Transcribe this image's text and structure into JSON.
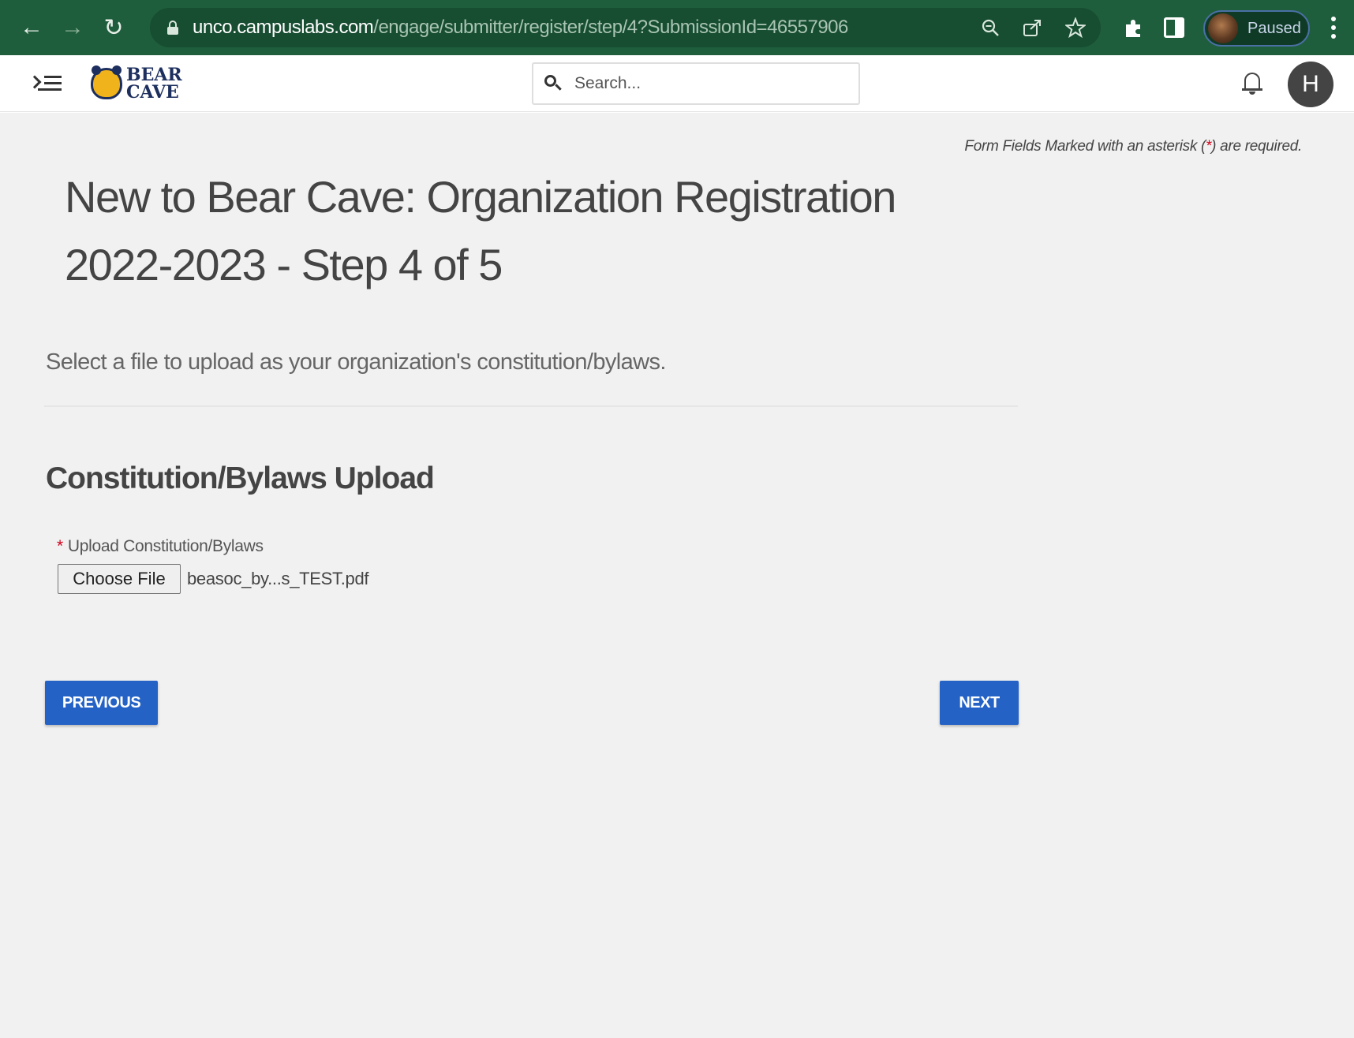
{
  "browser": {
    "url_host": "unco.campuslabs.com",
    "url_path": "/engage/submitter/register/step/4?SubmissionId=46557906",
    "profile_label": "Paused",
    "icons": [
      "back-arrow-icon",
      "forward-arrow-icon",
      "reload-icon",
      "lock-icon",
      "zoom-icon",
      "share-icon",
      "star-icon",
      "puzzle-icon",
      "side-panel-icon",
      "menu-dots-icon"
    ]
  },
  "header": {
    "logo_line1": "BEAR",
    "logo_line2": "CAVE",
    "search_placeholder": "Search...",
    "avatar_initial": "H"
  },
  "form": {
    "required_note_prefix": "Form Fields Marked with an asterisk (",
    "required_note_asterisk": "*",
    "required_note_suffix": ") are required.",
    "title": "New to Bear Cave: Organization Registration 2022-2023 - Step 4 of 5",
    "subtitle": "Select a file to upload as your organization's constitution/bylaws.",
    "section_title": "Constitution/Bylaws Upload",
    "field_required_mark": "*",
    "field_label": "Upload Constitution/Bylaws",
    "choose_file_label": "Choose File",
    "file_name": "beasoc_by...s_TEST.pdf"
  },
  "buttons": {
    "previous": "PREVIOUS",
    "next": "NEXT"
  },
  "colors": {
    "browser_bar": "#1e5e3c",
    "primary_button": "#2462c6",
    "required_red": "#d0021b",
    "brand_navy": "#1d2f5e",
    "brand_gold": "#f1b31c"
  }
}
